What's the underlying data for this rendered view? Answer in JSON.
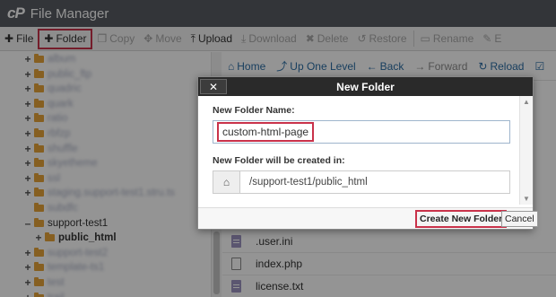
{
  "app": {
    "logo": "cP",
    "title": "File Manager"
  },
  "toolbar": {
    "items": [
      {
        "label": "File",
        "icon": "plus-icon",
        "glyph": "✚",
        "enabled": true
      },
      {
        "label": "Folder",
        "icon": "plus-icon",
        "glyph": "✚",
        "enabled": true,
        "highlighted": true
      },
      {
        "label": "Copy",
        "icon": "copy-icon",
        "glyph": "❐",
        "enabled": false
      },
      {
        "label": "Move",
        "icon": "move-icon",
        "glyph": "✥",
        "enabled": false
      },
      {
        "label": "Upload",
        "icon": "upload-icon",
        "glyph": "⤒",
        "enabled": true
      },
      {
        "label": "Download",
        "icon": "download-icon",
        "glyph": "⤓",
        "enabled": false
      },
      {
        "label": "Delete",
        "icon": "delete-icon",
        "glyph": "✖",
        "enabled": false
      },
      {
        "label": "Restore",
        "icon": "restore-icon",
        "glyph": "↺",
        "enabled": false
      },
      {
        "label": "Rename",
        "icon": "rename-icon",
        "glyph": "▭",
        "enabled": false
      },
      {
        "label": "E",
        "icon": "edit-icon",
        "glyph": "✎",
        "enabled": false
      }
    ]
  },
  "tree": {
    "items": [
      {
        "label": "album",
        "toggle": "+",
        "blurred": true
      },
      {
        "label": "public_ftp",
        "toggle": "+",
        "blurred": true
      },
      {
        "label": "quadric",
        "toggle": "+",
        "blurred": true
      },
      {
        "label": "quark",
        "toggle": "+",
        "blurred": true
      },
      {
        "label": "ratio",
        "toggle": "+",
        "blurred": true
      },
      {
        "label": "rbfzp",
        "toggle": "+",
        "blurred": true
      },
      {
        "label": "shuffle",
        "toggle": "+",
        "blurred": true
      },
      {
        "label": "skyetheme",
        "toggle": "+",
        "blurred": true
      },
      {
        "label": "ssl",
        "toggle": "+",
        "blurred": true
      },
      {
        "label": "staging.support-test1.stru.ts",
        "toggle": "+",
        "blurred": true
      },
      {
        "label": "subdfc",
        "toggle": "",
        "blurred": true
      },
      {
        "label": "support-test1",
        "toggle": "–",
        "blurred": false
      },
      {
        "label": "public_html",
        "toggle": "+",
        "blurred": false,
        "bold": true,
        "child": true
      },
      {
        "label": "support-test2",
        "toggle": "+",
        "blurred": true
      },
      {
        "label": "template-ts1",
        "toggle": "+",
        "blurred": true
      },
      {
        "label": "test",
        "toggle": "+",
        "blurred": true
      },
      {
        "label": "trail",
        "toggle": "+",
        "blurred": true
      }
    ]
  },
  "nav": {
    "items": [
      {
        "label": "Home",
        "icon": "home-icon",
        "glyph": "⌂",
        "enabled": true
      },
      {
        "label": "Up One Level",
        "icon": "arrow-up-icon",
        "glyph": "⤴",
        "enabled": true
      },
      {
        "label": "Back",
        "icon": "arrow-left-icon",
        "glyph": "←",
        "enabled": true
      },
      {
        "label": "Forward",
        "icon": "arrow-right-icon",
        "glyph": "→",
        "enabled": false
      },
      {
        "label": "Reload",
        "icon": "reload-icon",
        "glyph": "↻",
        "enabled": true
      },
      {
        "label": "",
        "icon": "check-icon",
        "glyph": "☑",
        "enabled": true
      }
    ]
  },
  "files": {
    "items": [
      {
        "name": ".user.ini",
        "icon": "file-icon"
      },
      {
        "name": "index.php",
        "icon": "html-file-icon"
      },
      {
        "name": "license.txt",
        "icon": "file-icon"
      }
    ]
  },
  "dialog": {
    "close_label": "✕",
    "title": "New Folder",
    "name_label": "New Folder Name:",
    "name_value": "custom-html-page",
    "path_label": "New Folder will be created in:",
    "path_icon": "home-icon",
    "path_value": "/support-test1/public_html",
    "create_label": "Create New Folder",
    "cancel_label": "Cancel"
  },
  "colors": {
    "titlebar": "#585c62",
    "highlight": "#c9324a",
    "link": "#2c6da4",
    "folder": "#e7a43a"
  }
}
